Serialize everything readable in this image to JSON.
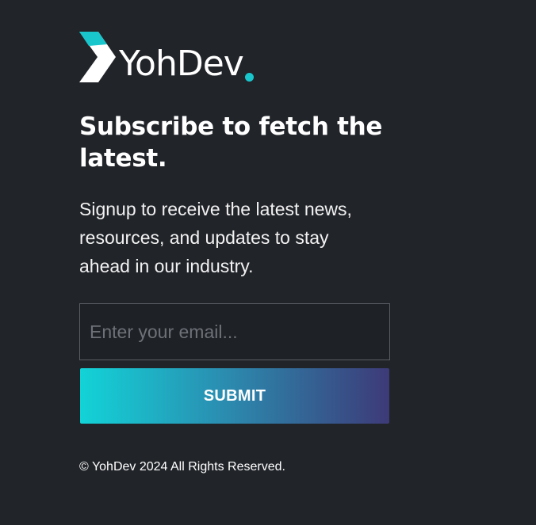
{
  "logo": {
    "text": "YohDev",
    "accent_color": "#19c6cc",
    "icon": "chevron-arrow-logo-icon"
  },
  "headline": "Subscribe to fetch the latest.",
  "description": "Signup to receive the latest news, resources, and updates to stay ahead in our industry.",
  "form": {
    "email_placeholder": "Enter your email...",
    "email_value": "",
    "submit_label": "SUBMIT"
  },
  "footer": {
    "copyright": "© YohDev 2024 All Rights Reserved."
  },
  "colors": {
    "background": "#212429",
    "text": "#ffffff",
    "button_gradient_start": "#12d3d7",
    "button_gradient_end": "#3d3a78"
  }
}
